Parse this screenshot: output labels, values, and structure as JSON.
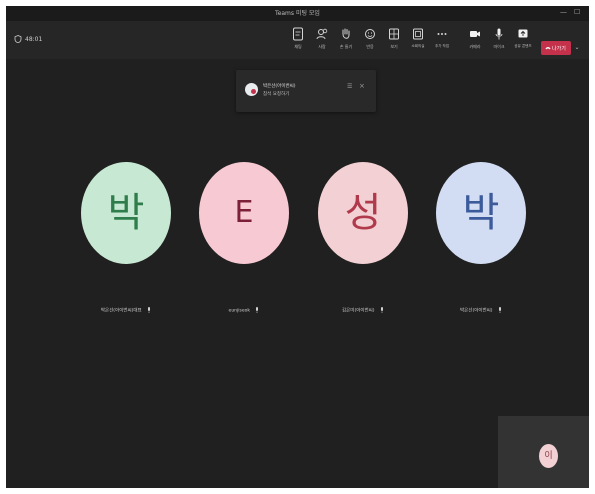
{
  "window": {
    "title": "Teams 미팅 모임",
    "minimize": "—",
    "maximize": "☐"
  },
  "meeting": {
    "timer": "48:01"
  },
  "toolbar": {
    "items": [
      {
        "label": "채팅",
        "icon": "chat-icon"
      },
      {
        "label": "사람",
        "icon": "people-icon"
      },
      {
        "label": "손 들기",
        "icon": "raise-hand-icon"
      },
      {
        "label": "반응",
        "icon": "reactions-icon"
      },
      {
        "label": "보기",
        "icon": "view-icon"
      },
      {
        "label": "소회의실",
        "icon": "breakout-rooms-icon"
      },
      {
        "label": "추가 작업",
        "icon": "more-icon"
      },
      {
        "label": "카메라",
        "icon": "camera-icon"
      },
      {
        "label": "마이크",
        "icon": "mic-icon"
      },
      {
        "label": "공유 콘텐츠",
        "icon": "share-icon"
      }
    ],
    "leave_label": "나가기",
    "leave_icon": "phone-icon",
    "leave_color": "#c4314b"
  },
  "toast": {
    "name": "박은선(아이번씨)",
    "message": "참석 요청하기"
  },
  "participants": [
    {
      "initial": "박",
      "name": "박은선(아이번씨)대표",
      "bg": "#c7e8d2",
      "fg": "#2f7d4a"
    },
    {
      "initial": "E",
      "name": "eunjiseok",
      "bg": "#f7c9d3",
      "fg": "#7c1f38"
    },
    {
      "initial": "성",
      "name": "김은미(아이번씨)",
      "bg": "#f2d0d3",
      "fg": "#b03a4b"
    },
    {
      "initial": "박",
      "name": "박은선(아이번씨)",
      "bg": "#d2ddf3",
      "fg": "#3c5b9b"
    }
  ],
  "self": {
    "initial": "이"
  }
}
